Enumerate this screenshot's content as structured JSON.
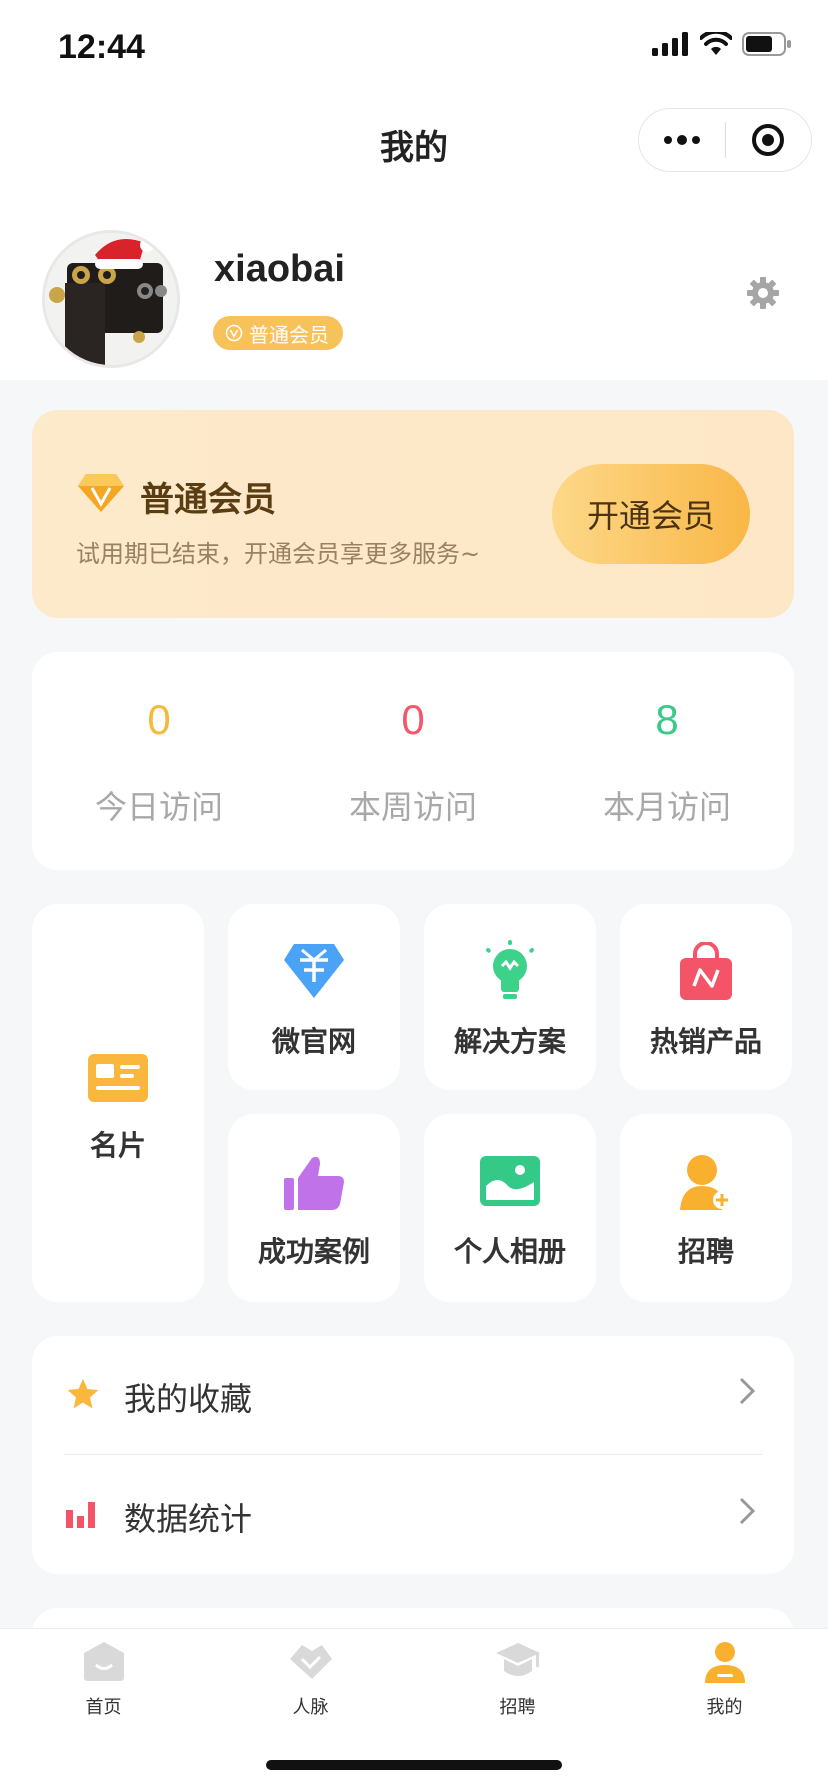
{
  "status_bar": {
    "time": "12:44"
  },
  "nav": {
    "title": "我的"
  },
  "profile": {
    "username": "xiaobai",
    "badge": "普通会员"
  },
  "vip_card": {
    "title": "普通会员",
    "subtitle": "试用期已结束，开通会员享更多服务~",
    "button": "开通会员"
  },
  "stats": [
    {
      "value": "0",
      "label": "今日访问",
      "color": "#f6b93b"
    },
    {
      "value": "0",
      "label": "本周访问",
      "color": "#f2596a"
    },
    {
      "value": "8",
      "label": "本月访问",
      "color": "#3cc886"
    }
  ],
  "grid": {
    "card": {
      "label": "名片",
      "color": "#f9b73e"
    },
    "items": [
      {
        "label": "微官网",
        "color": "#4aa3f5",
        "icon": "diamond-icon"
      },
      {
        "label": "解决方案",
        "color": "#3cd28a",
        "icon": "lightbulb-icon"
      },
      {
        "label": "热销产品",
        "color": "#f35468",
        "icon": "shopping-bag-icon"
      },
      {
        "label": "成功案例",
        "color": "#c072e8",
        "icon": "thumbs-up-icon"
      },
      {
        "label": "个人相册",
        "color": "#34c986",
        "icon": "photo-icon"
      },
      {
        "label": "招聘",
        "color": "#f9b02f",
        "icon": "person-add-icon"
      }
    ]
  },
  "menu": [
    {
      "label": "我的收藏",
      "icon": "star-icon",
      "color": "#f9b73e"
    },
    {
      "label": "数据统计",
      "icon": "bar-chart-icon",
      "color": "#f35468"
    }
  ],
  "tabbar": [
    {
      "label": "首页",
      "icon": "home-icon",
      "active": false
    },
    {
      "label": "人脉",
      "icon": "handshake-icon",
      "active": false
    },
    {
      "label": "招聘",
      "icon": "graduation-cap-icon",
      "active": false
    },
    {
      "label": "我的",
      "icon": "user-icon",
      "active": true
    }
  ],
  "colors": {
    "accent": "#f9b02f",
    "inactive_icon": "#d9d9d9"
  }
}
